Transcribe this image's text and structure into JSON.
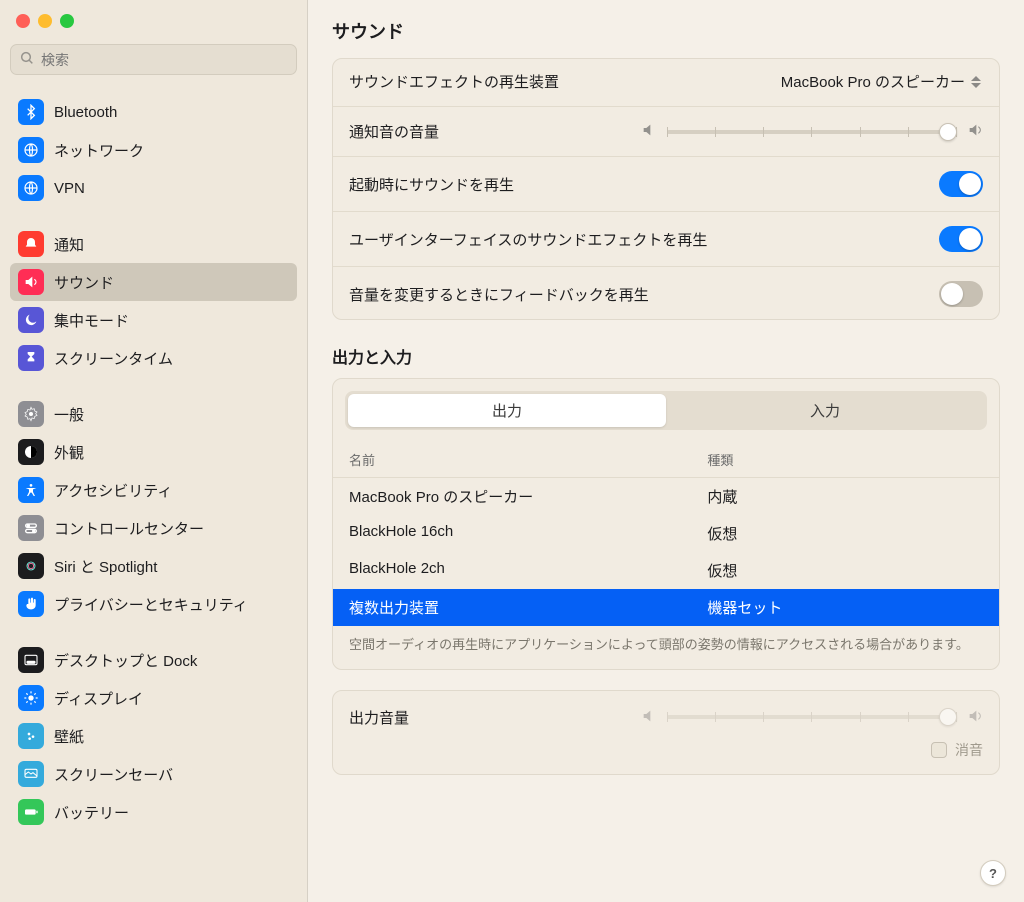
{
  "search": {
    "placeholder": "検索"
  },
  "sidebar": {
    "groups": [
      {
        "items": [
          {
            "id": "bluetooth",
            "label": "Bluetooth",
            "icon": "bluetooth",
            "color": "#0a7aff"
          },
          {
            "id": "network",
            "label": "ネットワーク",
            "icon": "globe",
            "color": "#0a7aff"
          },
          {
            "id": "vpn",
            "label": "VPN",
            "icon": "vpn",
            "color": "#0a7aff"
          }
        ]
      },
      {
        "items": [
          {
            "id": "notifications",
            "label": "通知",
            "icon": "bell",
            "color": "#ff3b30"
          },
          {
            "id": "sound",
            "label": "サウンド",
            "icon": "sound",
            "color": "#ff2d55",
            "selected": true
          },
          {
            "id": "focus",
            "label": "集中モード",
            "icon": "moon",
            "color": "#5856d6"
          },
          {
            "id": "screentime",
            "label": "スクリーンタイム",
            "icon": "hourglass",
            "color": "#5856d6"
          }
        ]
      },
      {
        "items": [
          {
            "id": "general",
            "label": "一般",
            "icon": "gear",
            "color": "#8e8e93"
          },
          {
            "id": "appearance",
            "label": "外観",
            "icon": "appearance",
            "color": "#1c1c1e"
          },
          {
            "id": "accessibility",
            "label": "アクセシビリティ",
            "icon": "accessibility",
            "color": "#0a7aff"
          },
          {
            "id": "controlcenter",
            "label": "コントロールセンター",
            "icon": "switches",
            "color": "#8e8e93"
          },
          {
            "id": "siri",
            "label": "Siri と Spotlight",
            "icon": "siri",
            "color": "#1c1c1e"
          },
          {
            "id": "privacy",
            "label": "プライバシーとセキュリティ",
            "icon": "hand",
            "color": "#0a7aff"
          }
        ]
      },
      {
        "items": [
          {
            "id": "desktop",
            "label": "デスクトップと Dock",
            "icon": "dock",
            "color": "#1c1c1e"
          },
          {
            "id": "display",
            "label": "ディスプレイ",
            "icon": "brightness",
            "color": "#0a7aff"
          },
          {
            "id": "wallpaper",
            "label": "壁紙",
            "icon": "wallpaper",
            "color": "#34aadc"
          },
          {
            "id": "screensaver",
            "label": "スクリーンセーバ",
            "icon": "screensaver",
            "color": "#34aadc"
          },
          {
            "id": "battery",
            "label": "バッテリー",
            "icon": "battery",
            "color": "#34c759"
          }
        ]
      }
    ]
  },
  "page": {
    "title": "サウンド",
    "effects": {
      "device_label": "サウンドエフェクトの再生装置",
      "device_value": "MacBook Pro のスピーカー",
      "alert_volume_label": "通知音の音量",
      "alert_volume_percent": 97,
      "startup_label": "起動時にサウンドを再生",
      "startup_on": true,
      "ui_effects_label": "ユーザインターフェイスのサウンドエフェクトを再生",
      "ui_effects_on": true,
      "feedback_label": "音量を変更するときにフィードバックを再生",
      "feedback_on": false
    },
    "io": {
      "section_title": "出力と入力",
      "tab_output": "出力",
      "tab_input": "入力",
      "active_tab": "output",
      "header_name": "名前",
      "header_type": "種類",
      "devices": [
        {
          "name": "MacBook Pro のスピーカー",
          "type": "内蔵",
          "selected": false
        },
        {
          "name": "BlackHole 16ch",
          "type": "仮想",
          "selected": false
        },
        {
          "name": "BlackHole 2ch",
          "type": "仮想",
          "selected": false
        },
        {
          "name": "複数出力装置",
          "type": "機器セット",
          "selected": true
        }
      ],
      "footnote": "空間オーディオの再生時にアプリケーションによって頭部の姿勢の情報にアクセスされる場合があります。"
    },
    "output_volume": {
      "label": "出力音量",
      "percent": 97,
      "disabled": true,
      "mute_label": "消音",
      "mute_checked": false
    }
  },
  "help_label": "?"
}
